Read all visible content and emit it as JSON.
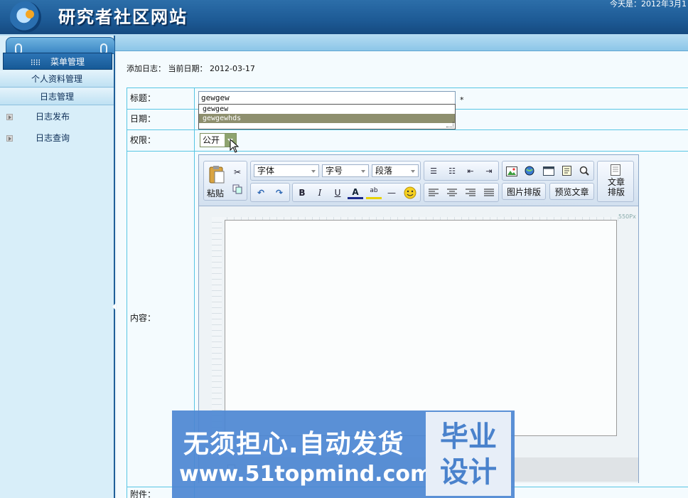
{
  "header": {
    "site_title": "研究者社区网站",
    "today_text": "今天是：2012年3月1"
  },
  "sidebar": {
    "menu_header": "菜单管理",
    "sections": [
      {
        "label": "个人资料管理"
      },
      {
        "label": "日志管理"
      }
    ],
    "items": [
      {
        "label": "日志发布"
      },
      {
        "label": "日志查询"
      }
    ]
  },
  "main": {
    "breadcrumb": "添加日志： 当前日期： 2012-03-17",
    "form": {
      "title_label": "标题：",
      "title_value": "gewgew",
      "required_mark": "*",
      "autocomplete_options": [
        "gewgew",
        "gewgewhds"
      ],
      "autocomplete_selected_index": 1,
      "date_label": "日期：",
      "permission_label": "权限：",
      "permission_value": "公开",
      "content_label": "内容：",
      "attachment_label": "附件："
    },
    "editor": {
      "paste_label": "粘贴",
      "font_combo": "字体",
      "size_combo": "字号",
      "paragraph_combo": "段落",
      "image_layout_button": "图片排版",
      "preview_button": "预览文章",
      "article_layout_button": "文章排版",
      "width_label": "550Px",
      "icons": [
        "cut-icon",
        "copy-icon",
        "undo-icon",
        "redo-icon",
        "bold-icon",
        "italic-icon",
        "underline-icon",
        "font-color-icon",
        "highlight-icon",
        "horizontal-rule-icon",
        "emoticon-icon",
        "ordered-list-icon",
        "unordered-list-icon",
        "outdent-icon",
        "indent-icon",
        "align-left-icon",
        "align-center-icon",
        "align-right-icon",
        "justify-icon",
        "insert-image-icon",
        "insert-link-icon",
        "insert-table-icon",
        "insert-template-icon",
        "find-icon"
      ]
    }
  },
  "banner": {
    "line1": "无须担心.自动发货",
    "line2": "www.51topmind.com",
    "box_text": "毕业设计"
  },
  "colors": {
    "header_blue": "#1d5a95",
    "grid_line": "#58c6e4",
    "banner_blue": "#4c87d3"
  }
}
